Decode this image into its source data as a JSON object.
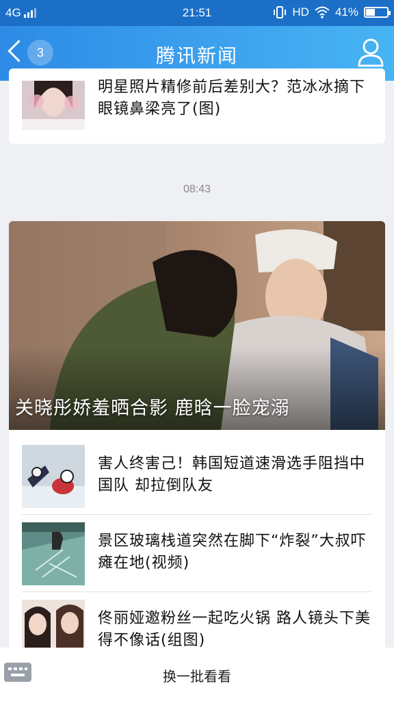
{
  "status_bar": {
    "network": "4G",
    "time": "21:51",
    "hd_label": "HD",
    "battery_percent": "41%"
  },
  "header": {
    "back_count": "3",
    "title": "腾讯新闻"
  },
  "top_item": {
    "headline": "明星照片精修前后差别大？范冰冰摘下眼镜鼻梁亮了(图)"
  },
  "timestamp": "08:43",
  "featured": {
    "caption": "关晓彤娇羞晒合影 鹿晗一脸宠溺"
  },
  "news_items": [
    {
      "headline": "害人终害己！韩国短道速滑选手阻挡中国队 却拉倒队友"
    },
    {
      "headline": "景区玻璃栈道突然在脚下“炸裂”大叔吓瘫在地(视频)"
    },
    {
      "headline": "佟丽娅邀粉丝一起吃火锅 路人镜头下美得不像话(组图)"
    }
  ],
  "bottom_bar": {
    "more_label": "换一批看看"
  },
  "colors": {
    "header_start": "#2d8be6",
    "header_end": "#47b4f3",
    "status_bar": "#1b6fc7"
  }
}
